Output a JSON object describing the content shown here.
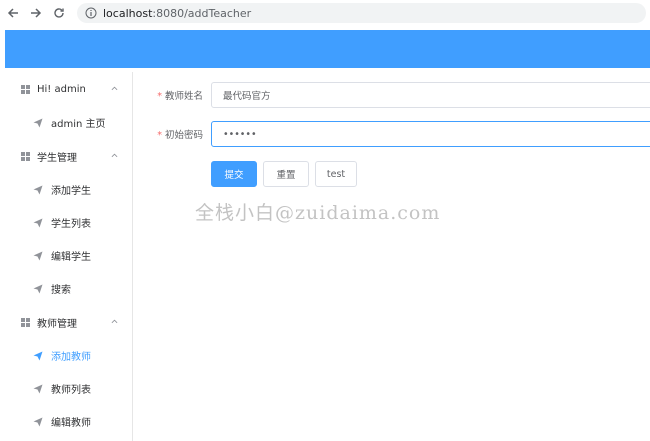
{
  "browser": {
    "url_host": "localhost",
    "url_path": ":8080/addTeacher"
  },
  "sidebar": {
    "groups": [
      {
        "title": "Hi! admin",
        "items": [
          {
            "label": "admin 主页"
          }
        ]
      },
      {
        "title": "学生管理",
        "items": [
          {
            "label": "添加学生"
          },
          {
            "label": "学生列表"
          },
          {
            "label": "编辑学生"
          },
          {
            "label": "搜索"
          }
        ]
      },
      {
        "title": "教师管理",
        "items": [
          {
            "label": "添加教师",
            "active": true
          },
          {
            "label": "教师列表"
          },
          {
            "label": "编辑教师"
          }
        ]
      }
    ]
  },
  "form": {
    "name_label": "教师姓名",
    "name_value": "最代码官方",
    "password_label": "初始密码",
    "password_value": "••••••",
    "required_mark": "*",
    "submit_label": "提交",
    "reset_label": "重置",
    "test_label": "test"
  },
  "watermark": "全栈小白@zuidaima.com",
  "colors": {
    "primary": "#409EFF",
    "required": "#F56C6C"
  }
}
